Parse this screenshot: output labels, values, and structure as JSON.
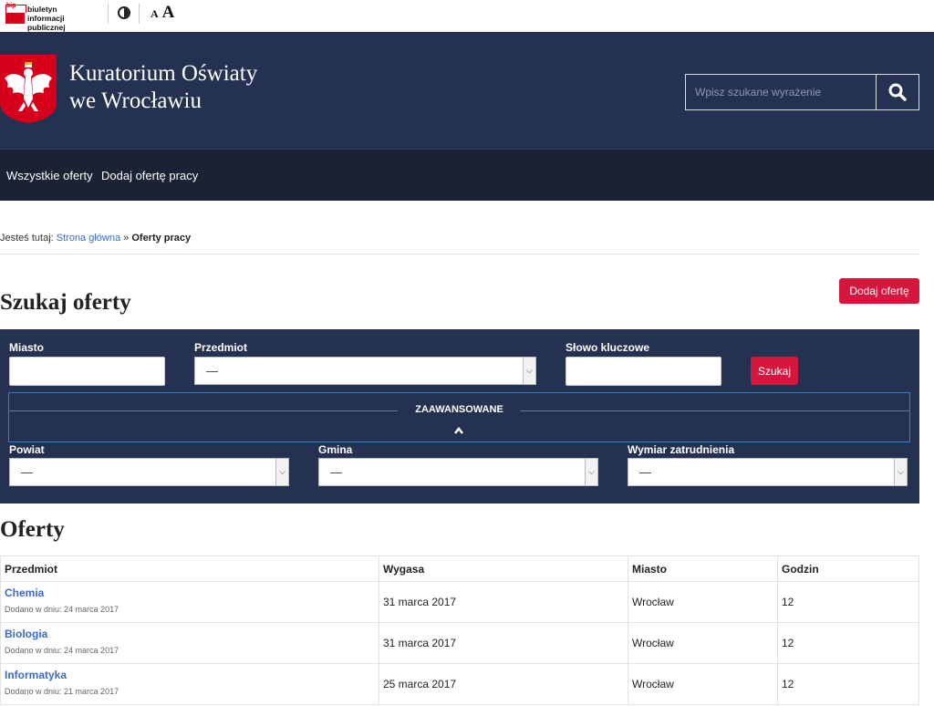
{
  "topbar": {
    "bip_flag_text": "bip",
    "bip_line1": "biuletyn",
    "bip_line2": "informacji publicznej",
    "font_small": "A",
    "font_big": "A"
  },
  "header": {
    "title_line1": "Kuratorium Oświaty",
    "title_line2": "we Wrocławiu",
    "search_placeholder": "Wpisz szukane wyrażenie"
  },
  "nav": {
    "items": [
      {
        "label": "Wszystkie oferty"
      },
      {
        "label": "Dodaj ofertę pracy"
      }
    ]
  },
  "breadcrumb": {
    "prefix": "Jesteś tutaj:",
    "home": "Strona główna",
    "separator": "»",
    "current": "Oferty pracy"
  },
  "search_section": {
    "heading": "Szukaj oferty",
    "add_button": "Dodaj ofertę",
    "fields": {
      "city_label": "Miasto",
      "subject_label": "Przedmiot",
      "subject_value": "—",
      "keyword_label": "Słowo kluczowe",
      "search_button": "Szukaj"
    },
    "advanced": {
      "label": "ZAAWANSOWANE",
      "district_label": "Powiat",
      "district_value": "—",
      "commune_label": "Gmina",
      "commune_value": "—",
      "employment_label": "Wymiar zatrudnienia",
      "employment_value": "—"
    }
  },
  "offers": {
    "heading": "Oferty",
    "columns": [
      "Przedmiot",
      "Wygasa",
      "Miasto",
      "Godzin"
    ],
    "rows": [
      {
        "subject": "Chemia",
        "added": "Dodano w dniu: 24 marca 2017",
        "expires": "31 marca 2017",
        "city": "Wrocław",
        "hours": "12"
      },
      {
        "subject": "Biologia",
        "added": "Dodano w dniu: 24 marca 2017",
        "expires": "31 marca 2017",
        "city": "Wrocław",
        "hours": "12"
      },
      {
        "subject": "Informatyka",
        "added": "Dodano w dniu: 21 marca 2017",
        "expires": "25 marca 2017",
        "city": "Wrocław",
        "hours": "12"
      }
    ]
  },
  "colors": {
    "header_bg": "#243151",
    "nav_bg": "#1b2233",
    "accent_red": "#d6173d",
    "link_blue": "#3a6bc4"
  },
  "icons": [
    "bip-logo-icon",
    "contrast-icon",
    "eagle-emblem-icon",
    "search-icon",
    "chevron-up-icon",
    "chevron-down-icon"
  ]
}
